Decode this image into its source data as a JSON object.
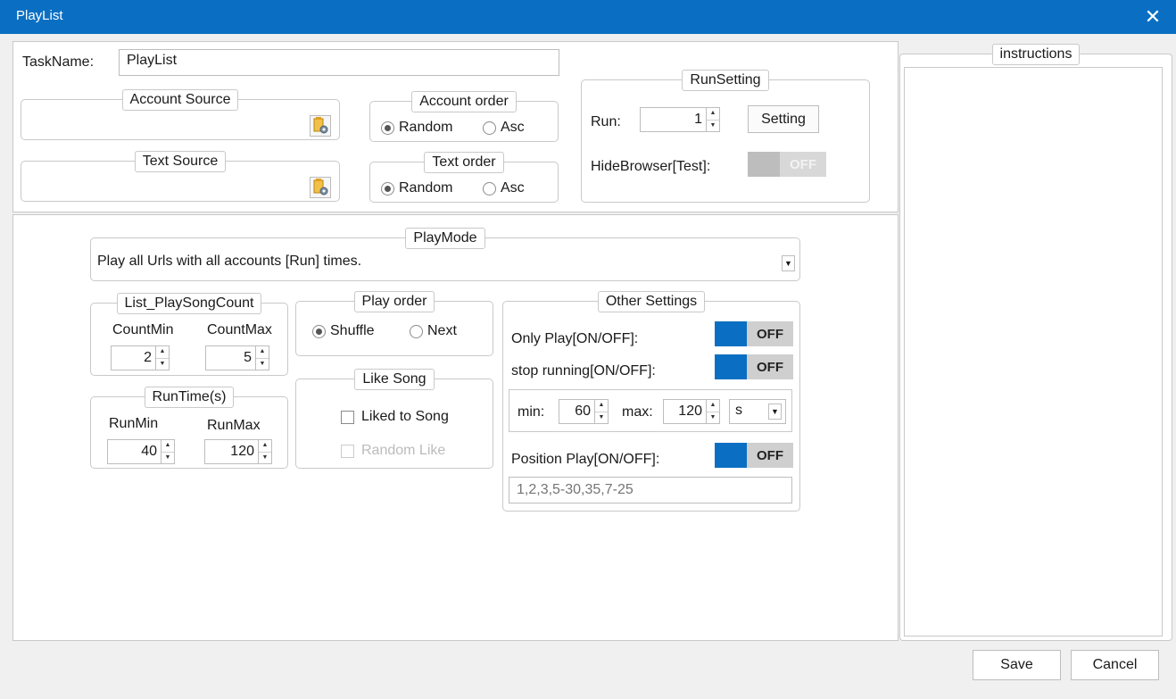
{
  "window": {
    "title": "PlayList",
    "close_glyph": "✕"
  },
  "task": {
    "label": "TaskName:",
    "value": "PlayList"
  },
  "account_source": {
    "legend": "Account Source",
    "icon": "folder-settings-icon"
  },
  "text_source": {
    "legend": "Text Source",
    "icon": "folder-settings-icon"
  },
  "account_order": {
    "legend": "Account order",
    "options": [
      "Random",
      "Asc"
    ],
    "selected": "Random"
  },
  "text_order": {
    "legend": "Text order",
    "options": [
      "Random",
      "Asc"
    ],
    "selected": "Random"
  },
  "run_setting": {
    "legend": "RunSetting",
    "run_label": "Run:",
    "run_value": "1",
    "setting_button": "Setting",
    "hide_browser_label": "HideBrowser[Test]:",
    "hide_browser_state": "OFF"
  },
  "instructions": {
    "legend": "instructions"
  },
  "play_mode": {
    "legend": "PlayMode",
    "selected": "Play all Urls with all accounts [Run] times."
  },
  "list_play_song_count": {
    "legend": "List_PlaySongCount",
    "min_label": "CountMin",
    "max_label": "CountMax",
    "min_value": "2",
    "max_value": "5"
  },
  "run_time": {
    "legend": "RunTime(s)",
    "min_label": "RunMin",
    "max_label": "RunMax",
    "min_value": "40",
    "max_value": "120"
  },
  "play_order": {
    "legend": "Play order",
    "options": [
      "Shuffle",
      "Next"
    ],
    "selected": "Shuffle"
  },
  "like_song": {
    "legend": "Like Song",
    "liked_label": "Liked to Song",
    "random_label": "Random Like"
  },
  "other_settings": {
    "legend": "Other Settings",
    "only_play_label": "Only Play[ON/OFF]:",
    "only_play_state": "OFF",
    "stop_running_label": "stop running[ON/OFF]:",
    "stop_running_state": "OFF",
    "min_label": "min:",
    "min_value": "60",
    "max_label": "max:",
    "max_value": "120",
    "unit": "s",
    "position_play_label": "Position Play[ON/OFF]:",
    "position_play_state": "OFF",
    "position_placeholder": "1,2,3,5-30,35,7-25"
  },
  "footer": {
    "save": "Save",
    "cancel": "Cancel"
  },
  "colors": {
    "accent": "#0a6fc2",
    "toggle_off": "#cfcfcf"
  }
}
